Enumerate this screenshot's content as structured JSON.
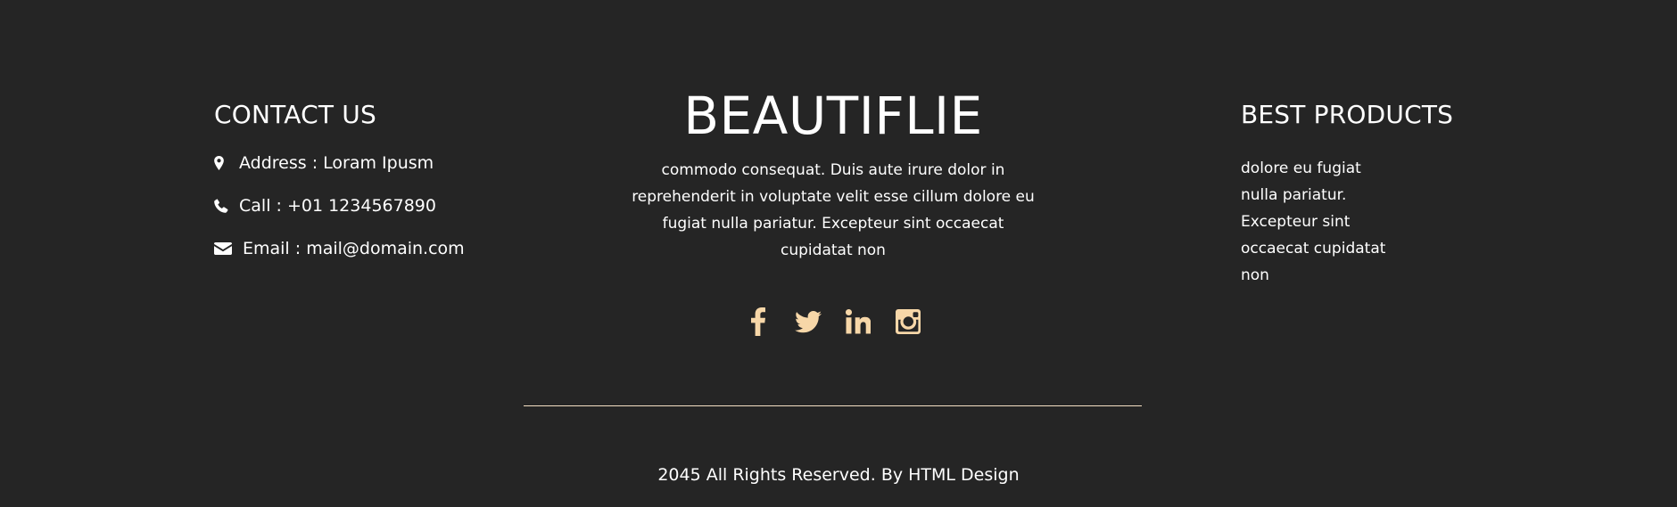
{
  "contact": {
    "heading": "CONTACT US",
    "items": [
      {
        "icon": "map-marker-icon",
        "label": "Address : Loram Ipusm"
      },
      {
        "icon": "phone-icon",
        "label": "Call : +01 1234567890"
      },
      {
        "icon": "envelope-icon",
        "label": "Email : mail@domain.com"
      }
    ]
  },
  "brand": {
    "title": "BEAUTIFLIE",
    "description": "commodo consequat. Duis aute irure dolor in reprehenderit in voluptate velit esse cillum dolore eu fugiat nulla pariatur. Excepteur sint occaecat cupidatat non"
  },
  "social": {
    "color": "#f7d7a8",
    "icons": [
      "facebook-icon",
      "twitter-icon",
      "linkedin-icon",
      "instagram-icon"
    ]
  },
  "products": {
    "heading": "BEST PRODUCTS",
    "description": "dolore eu fugiat nulla pariatur. Excepteur sint occaecat cupidatat non"
  },
  "footer": {
    "copyright": "2045 All Rights Reserved. By HTML Design"
  },
  "colors": {
    "background": "#252525",
    "text": "#ffffff",
    "accent": "#f7d7a8"
  }
}
